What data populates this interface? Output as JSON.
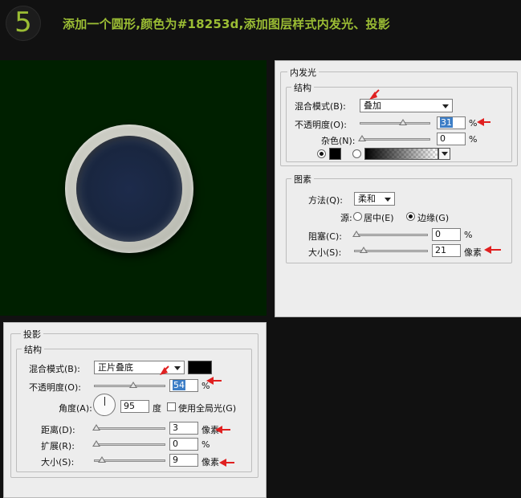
{
  "step": {
    "number": "5"
  },
  "headline": "添加一个圆形,颜色为#18253d,添加图层样式内发光、投影",
  "colors": {
    "accent_text": "#9bbd34",
    "preview_bg": "#002000",
    "circle_fill": "#18253d",
    "annotation_arrow": "#e02020"
  },
  "inner_glow_panel": {
    "title": "内发光",
    "structure": {
      "title": "结构",
      "blend_mode_label": "混合模式(B):",
      "blend_mode_value": "叠加",
      "opacity_label": "不透明度(O):",
      "opacity_value": "31",
      "opacity_unit": "%",
      "noise_label": "杂色(N):",
      "noise_value": "0",
      "noise_unit": "%"
    },
    "elements": {
      "title": "图素",
      "method_label": "方法(Q):",
      "method_value": "柔和",
      "source_label": "源:",
      "source_center": "居中(E)",
      "source_edge": "边缘(G)",
      "choke_label": "阻塞(C):",
      "choke_value": "0",
      "choke_unit": "%",
      "size_label": "大小(S):",
      "size_value": "21",
      "size_unit": "像素"
    }
  },
  "drop_shadow_panel": {
    "title": "投影",
    "structure": {
      "title": "结构",
      "blend_mode_label": "混合模式(B):",
      "blend_mode_value": "正片叠底",
      "opacity_label": "不透明度(O):",
      "opacity_value": "54",
      "opacity_unit": "%",
      "angle_label": "角度(A):",
      "angle_value": "95",
      "angle_unit": "度",
      "global_light_label": "使用全局光(G)",
      "distance_label": "距离(D):",
      "distance_value": "3",
      "distance_unit": "像素",
      "spread_label": "扩展(R):",
      "spread_value": "0",
      "spread_unit": "%",
      "size_label": "大小(S):",
      "size_value": "9",
      "size_unit": "像素"
    }
  }
}
